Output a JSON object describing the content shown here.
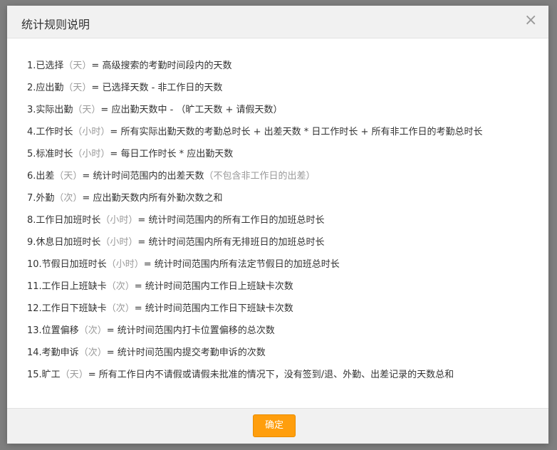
{
  "dialog": {
    "title": "统计规则说明",
    "close_icon": "close-icon",
    "confirm_label": "确定"
  },
  "rules": [
    {
      "prefix": "1.已选择",
      "unit": "（天）",
      "text": "= 高级搜索的考勤时间段内的天数",
      "note": ""
    },
    {
      "prefix": "2.应出勤",
      "unit": "（天）",
      "text": "= 已选择天数 - 非工作日的天数",
      "note": ""
    },
    {
      "prefix": "3.实际出勤",
      "unit": "（天）",
      "text": "= 应出勤天数中 - （旷工天数 + 请假天数）",
      "note": ""
    },
    {
      "prefix": "4.工作时长",
      "unit": "（小时）",
      "text": "= 所有实际出勤天数的考勤总时长 + 出差天数 * 日工作时长 + 所有非工作日的考勤总时长",
      "note": ""
    },
    {
      "prefix": "5.标准时长",
      "unit": "（小时）",
      "text": "= 每日工作时长 * 应出勤天数",
      "note": ""
    },
    {
      "prefix": "6.出差",
      "unit": "（天）",
      "text": "= 统计时间范围内的出差天数",
      "note": "（不包含非工作日的出差）"
    },
    {
      "prefix": "7.外勤",
      "unit": "（次）",
      "text": "= 应出勤天数内所有外勤次数之和",
      "note": ""
    },
    {
      "prefix": "8.工作日加班时长",
      "unit": "（小时）",
      "text": "= 统计时间范围内的所有工作日的加班总时长",
      "note": ""
    },
    {
      "prefix": "9.休息日加班时长",
      "unit": "（小时）",
      "text": "= 统计时间范围内所有无排班日的加班总时长",
      "note": ""
    },
    {
      "prefix": "10.节假日加班时长",
      "unit": "（小时）",
      "text": "= 统计时间范围内所有法定节假日的加班总时长",
      "note": ""
    },
    {
      "prefix": "11.工作日上班缺卡",
      "unit": "（次）",
      "text": "= 统计时间范围内工作日上班缺卡次数",
      "note": ""
    },
    {
      "prefix": "12.工作日下班缺卡",
      "unit": "（次）",
      "text": "= 统计时间范围内工作日下班缺卡次数",
      "note": ""
    },
    {
      "prefix": "13.位置偏移",
      "unit": "（次）",
      "text": "= 统计时间范围内打卡位置偏移的总次数",
      "note": ""
    },
    {
      "prefix": "14.考勤申诉",
      "unit": "（次）",
      "text": "= 统计时间范围内提交考勤申诉的次数",
      "note": ""
    },
    {
      "prefix": "15.旷工",
      "unit": "（天）",
      "text": "= 所有工作日内不请假或请假未批准的情况下，没有签到/退、外勤、出差记录的天数总和",
      "note": ""
    }
  ],
  "colors": {
    "accent": "#ff9e0d",
    "header_bg": "#f1f1f1",
    "unit_text": "#999999"
  }
}
